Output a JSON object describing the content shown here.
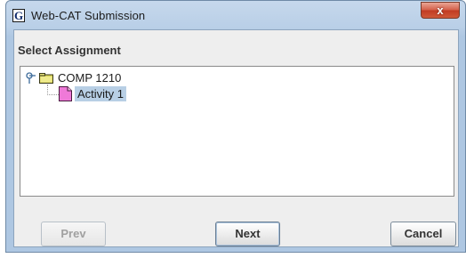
{
  "window": {
    "title": "Web-CAT Submission",
    "app_icon_letter": "G",
    "close_glyph": "x"
  },
  "content": {
    "heading": "Select Assignment"
  },
  "tree": {
    "root": {
      "label": "COMP 1210",
      "icon": "folder-icon",
      "expanded": true
    },
    "children": [
      {
        "label": "Activity 1",
        "icon": "document-icon",
        "selected": true
      }
    ]
  },
  "buttons": {
    "prev_label": "Prev",
    "next_label": "Next",
    "cancel_label": "Cancel"
  }
}
